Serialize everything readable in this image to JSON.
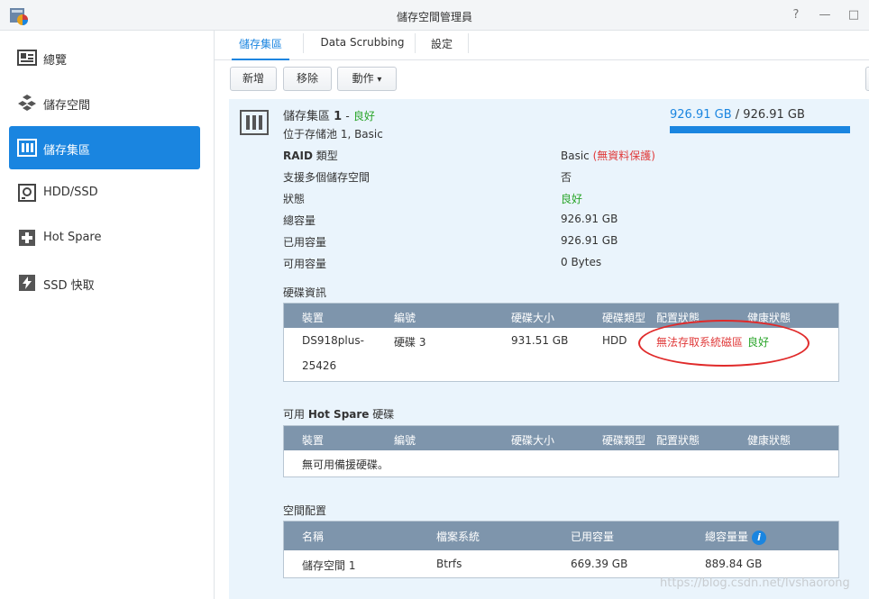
{
  "window": {
    "title": "儲存空間管理員",
    "help": "?",
    "minimize": "—",
    "maximize": "□"
  },
  "sidebar": {
    "items": [
      {
        "label": "總覽",
        "icon": "overview-icon"
      },
      {
        "label": "儲存空間",
        "icon": "volume-icon"
      },
      {
        "label": "儲存集區",
        "icon": "storage-pool-icon",
        "active": true
      },
      {
        "label": "HDD/SSD",
        "icon": "hdd-icon"
      },
      {
        "label": "Hot Spare",
        "icon": "hot-spare-icon"
      },
      {
        "label": "SSD 快取",
        "icon": "ssd-cache-icon"
      }
    ]
  },
  "tabs": [
    {
      "label": "儲存集區",
      "active": true
    },
    {
      "label": "Data Scrubbing"
    },
    {
      "label": "設定"
    }
  ],
  "toolbar": {
    "create": "新增",
    "remove": "移除",
    "action": "動作",
    "action_arrow": "▾"
  },
  "pool": {
    "name": "儲存集區",
    "number": "1",
    "separator": "-",
    "status": "良好",
    "location": "位于存储池 1, Basic",
    "used_capacity": "926.91 GB",
    "slash": "/",
    "total_capacity": "926.91 GB",
    "usage_fraction": 1.0,
    "info": [
      {
        "label_bold": "RAID",
        "label": " 類型",
        "value": "Basic",
        "value_note": "(無資料保護)"
      },
      {
        "label": "支援多個儲存空間",
        "value": "否"
      },
      {
        "label": "狀態",
        "value": "良好",
        "value_color": "green"
      },
      {
        "label": "總容量",
        "value": "926.91 GB"
      },
      {
        "label": "已用容量",
        "value": "926.91 GB"
      },
      {
        "label": "可用容量",
        "value": "0 Bytes"
      }
    ]
  },
  "disk_info": {
    "title": "硬碟資訊",
    "columns": [
      "裝置",
      "編號",
      "硬碟大小",
      "硬碟類型",
      "配置狀態",
      "健康狀態"
    ],
    "rows": [
      {
        "device_line1": "DS918plus-",
        "device_line2": "25426",
        "number": "硬碟 3",
        "size": "931.51 GB",
        "type": "HDD",
        "alloc_status": "無法存取系統磁區",
        "health": "良好"
      }
    ]
  },
  "hot_spare": {
    "title_prefix": "可用",
    "title_bold": "Hot Spare",
    "title_suffix": " 硬碟",
    "columns": [
      "裝置",
      "編號",
      "硬碟大小",
      "硬碟類型",
      "配置狀態",
      "健康狀態"
    ],
    "empty_text": "無可用備援硬碟。"
  },
  "space_allocation": {
    "title": "空間配置",
    "columns": [
      "名稱",
      "檔案系統",
      "已用容量",
      "總容量量"
    ],
    "info_icon": "i",
    "rows": [
      {
        "name": "儲存空間 1",
        "fs": "Btrfs",
        "used": "669.39 GB",
        "total": "889.84 GB"
      }
    ]
  },
  "watermark": "https://blog.csdn.net/lvshaorong",
  "colors": {
    "accent": "#1a85e0",
    "good": "#2aa52a",
    "warn": "#e03b3b",
    "header": "#7e95ac",
    "panel": "#eaf4fc"
  }
}
